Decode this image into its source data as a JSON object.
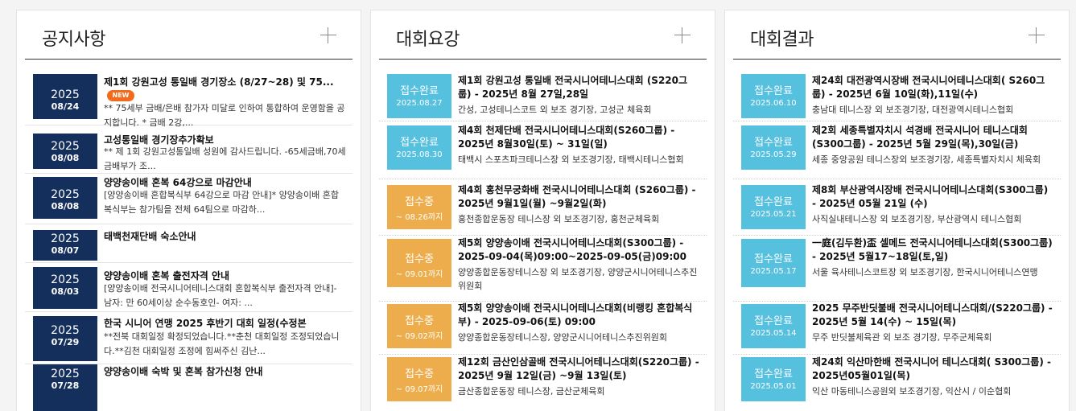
{
  "notices": {
    "title": "공지사항",
    "new_badge": "NEW",
    "items": [
      {
        "year": "2025",
        "md": "08/24",
        "title": "제1회 강원고성 통일배 경기장소 (8/27~28) 및 75...",
        "desc": "** 75세부 금배/은배 참가자 미달로 인하여 통합하여 운영함을 공지합니다.  * 금배 2강,..."
      },
      {
        "year": "2025",
        "md": "08/08",
        "title": "고성통일배 경기장추가확보",
        "desc": "** 제 1회 강원고성통일배 성원에 감사드립니다.    -65세금배,70세금배부가 조..."
      },
      {
        "year": "2025",
        "md": "08/08",
        "title": "양양송이배 혼복 64강으로 마감안내",
        "desc": "[양양송이배 혼합복식부 64강으로 마감 안내]* 양양송이배 혼합복식부는 참가팀을 전체 64팀으로 마감하..."
      },
      {
        "year": "2025",
        "md": "08/07",
        "title": "태백천재단배 숙소안내",
        "desc": ""
      },
      {
        "year": "2025",
        "md": "08/03",
        "title": "양양송이배 혼복 출전자격 안내",
        "desc": "[양양송이배 전국시니어테니스대회 혼합복식부 출전자격 안내]- 남자: 만 60세이상 순수동호인- 여자: ..."
      },
      {
        "year": "2025",
        "md": "07/29",
        "title": "한국 시니어 연맹 2025 후반기 대회 일정(수정본",
        "desc": "**전북 대회일정 확정되었습니다.**춘천 대회일정 조정되었습니다.**김천 대회일정 조정에 힘써주신 김난..."
      },
      {
        "year": "2025",
        "md": "07/28",
        "title": "양양송이배 숙박 및 혼복 참가신청 안내",
        "desc": ""
      }
    ]
  },
  "guidelines": {
    "title": "대회요강",
    "items": [
      {
        "status": "접수완료",
        "date": "2025.08.27",
        "state": "done",
        "title": "제1회 강원고성 통일배 전국시니어테니스대회 (S220그룹) - 2025년 8월 27일,28일",
        "venue": "간성, 고성테니스코트 외 보조 경기장, 고성군 체육회"
      },
      {
        "status": "접수완료",
        "date": "2025.08.30",
        "state": "done",
        "title": "제4회 천제단배 전국시니어테니스대회(S260그룹) - 2025년 8월30일(토) ~ 31일(일)",
        "venue": "태백시 스포츠파크테니스장 외 보조경기장, 태백시테니스협회"
      },
      {
        "status": "접수중",
        "date": "~ 08.26까지",
        "state": "open",
        "title": "제4회 홍천무궁화배 전국시니어테니스대회 (S260그룹) - 2025년 9월1일(월) ~9월2일(화)",
        "venue": "홍천종합운동장 테니스장 외 보조경기장, 홍천군체육회"
      },
      {
        "status": "접수중",
        "date": "~ 09.01까지",
        "state": "open",
        "title": "제5회 양양송이배 전국시니어테니스대회(S300그룹) - 2025-09-04(목)09:00~2025-09-05(금)09:00",
        "venue": "양양종합운동장테니스장 외 보조경기장, 양양군시니어테니스추진위원회"
      },
      {
        "status": "접수중",
        "date": "~ 09.02까지",
        "state": "open",
        "title": "제5회 양양송이배 전국시니어테니스대회(비랭킹 혼합복식부) - 2025-09-06(토) 09:00",
        "venue": "양양종합운동장테니스장, 양양군시니어테니스추진위원회"
      },
      {
        "status": "접수중",
        "date": "~ 09.07까지",
        "state": "open",
        "title": "제12회 금산인삼골배 전국시니어테니스대회(S220그룹) - 2025년 9월 12일(금) ~9월 13일(토)",
        "venue": "금산종합운동장 테니스장, 금산군체육회"
      }
    ]
  },
  "results": {
    "title": "대회결과",
    "items": [
      {
        "status": "접수완료",
        "date": "2025.06.10",
        "state": "done",
        "title": "제24회 대전광역시장배 전국시니어테니스대회( S260그룹) - 2025년 6월 10일(화),11일(수)",
        "venue": "충남대 테니스장 외 보조경기장, 대전광역시테니스협회"
      },
      {
        "status": "접수완료",
        "date": "2025.05.29",
        "state": "done",
        "title": "제2회 세종특별자치시 석경배 전국시니어 테니스대회(S300그룹) - 2025년 5월 29일(목),30일(금)",
        "venue": "세종 중앙공원 테니스장외 보조경기장, 세종특별자치시 체육회"
      },
      {
        "status": "접수완료",
        "date": "2025.05.21",
        "state": "done",
        "title": "제8회 부산광역시장배 전국시니어테니스대회(S300그룹) - 2025년 05월 21일 (수)",
        "venue": "사직실내테니스장 외 보조경기장, 부산광역시 테니스협회"
      },
      {
        "status": "접수완료",
        "date": "2025.05.17",
        "state": "done",
        "title": "一庭(김두환)盃 셀메드 전국시니어테니스대회(S300그룹) - 2025년 5월17~18일(토,일)",
        "venue": "서울 육사테니스코트장 외 보조경기장, 한국시니어테니스연맹"
      },
      {
        "status": "접수완료",
        "date": "2025.05.14",
        "state": "done",
        "title": "2025 무주반딧불배 전국시니어테니스대회/(S220그룹) - 2025년 5월 14(수) ~ 15일(목)",
        "venue": "무주 반딧불체육관 외 보조 경기장, 무주군체육회"
      },
      {
        "status": "접수완료",
        "date": "2025.05.01",
        "state": "done",
        "title": "제24회 익산마한배 전국시니어 테니스대회( S300그룹) - 2025년05월01일(목)",
        "venue": "익산 마동테니스공원외 보조경기장, 익산시 / 이순협회"
      }
    ]
  }
}
